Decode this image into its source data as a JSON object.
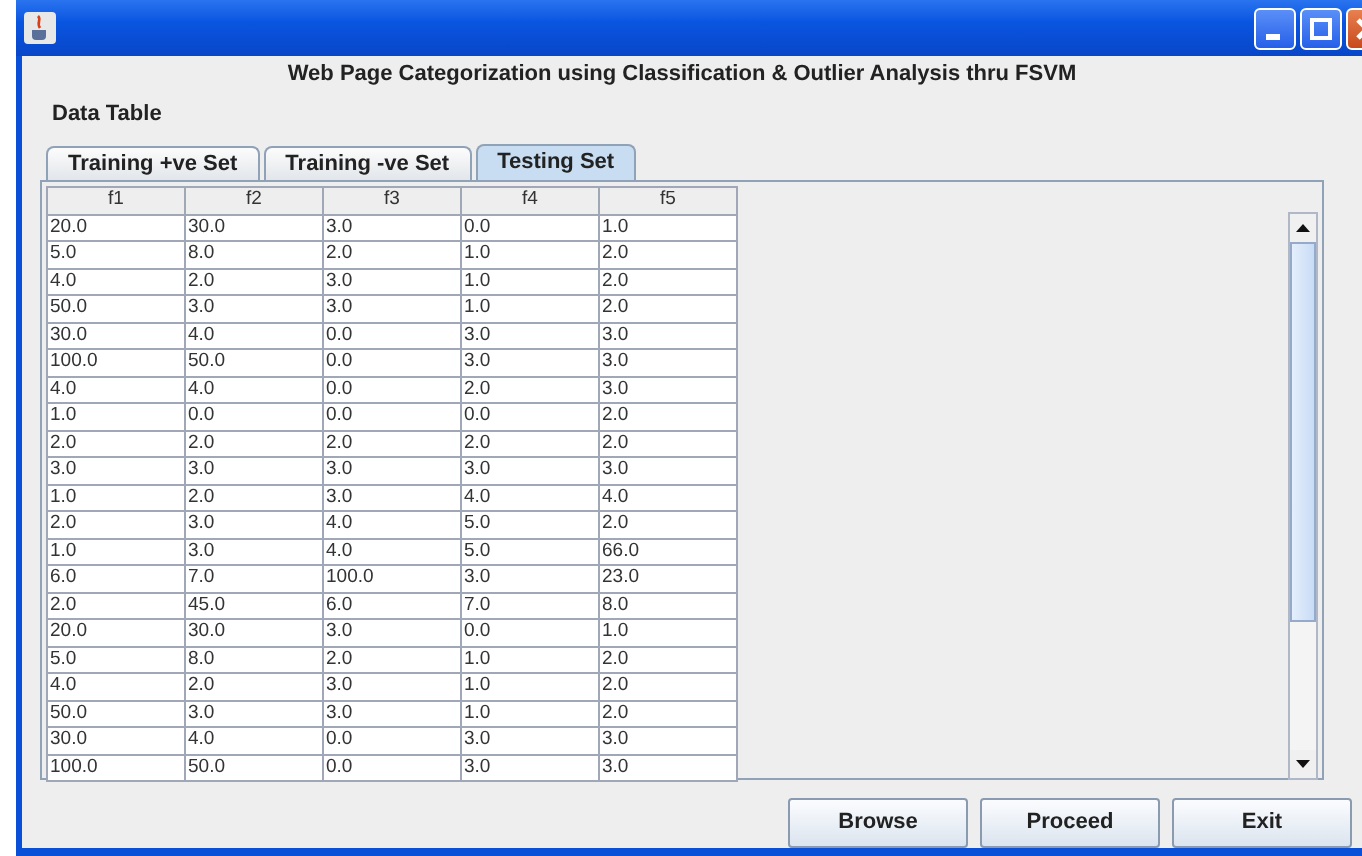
{
  "header": {
    "title": "Web Page Categorization using Classification & Outlier Analysis thru FSVM",
    "subtitle": "Data Table"
  },
  "tabs": [
    {
      "label": "Training +ve Set",
      "selected": false
    },
    {
      "label": "Training -ve Set",
      "selected": false
    },
    {
      "label": "Testing Set",
      "selected": true
    }
  ],
  "table": {
    "columns": [
      "f1",
      "f2",
      "f3",
      "f4",
      "f5"
    ],
    "rows": [
      [
        "20.0",
        "30.0",
        "3.0",
        "0.0",
        "1.0"
      ],
      [
        "5.0",
        "8.0",
        "2.0",
        "1.0",
        "2.0"
      ],
      [
        "4.0",
        "2.0",
        "3.0",
        "1.0",
        "2.0"
      ],
      [
        "50.0",
        "3.0",
        "3.0",
        "1.0",
        "2.0"
      ],
      [
        "30.0",
        "4.0",
        "0.0",
        "3.0",
        "3.0"
      ],
      [
        "100.0",
        "50.0",
        "0.0",
        "3.0",
        "3.0"
      ],
      [
        "4.0",
        "4.0",
        "0.0",
        "2.0",
        "3.0"
      ],
      [
        "1.0",
        "0.0",
        "0.0",
        "0.0",
        "2.0"
      ],
      [
        "2.0",
        "2.0",
        "2.0",
        "2.0",
        "2.0"
      ],
      [
        "3.0",
        "3.0",
        "3.0",
        "3.0",
        "3.0"
      ],
      [
        "1.0",
        "2.0",
        "3.0",
        "4.0",
        "4.0"
      ],
      [
        "2.0",
        "3.0",
        "4.0",
        "5.0",
        "2.0"
      ],
      [
        "1.0",
        "3.0",
        "4.0",
        "5.0",
        "66.0"
      ],
      [
        "6.0",
        "7.0",
        "100.0",
        "3.0",
        "23.0"
      ],
      [
        "2.0",
        "45.0",
        "6.0",
        "7.0",
        "8.0"
      ],
      [
        "20.0",
        "30.0",
        "3.0",
        "0.0",
        "1.0"
      ],
      [
        "5.0",
        "8.0",
        "2.0",
        "1.0",
        "2.0"
      ],
      [
        "4.0",
        "2.0",
        "3.0",
        "1.0",
        "2.0"
      ],
      [
        "50.0",
        "3.0",
        "3.0",
        "1.0",
        "2.0"
      ],
      [
        "30.0",
        "4.0",
        "0.0",
        "3.0",
        "3.0"
      ],
      [
        "100.0",
        "50.0",
        "0.0",
        "3.0",
        "3.0"
      ]
    ]
  },
  "buttons": [
    "Browse",
    "Proceed",
    "Exit"
  ]
}
